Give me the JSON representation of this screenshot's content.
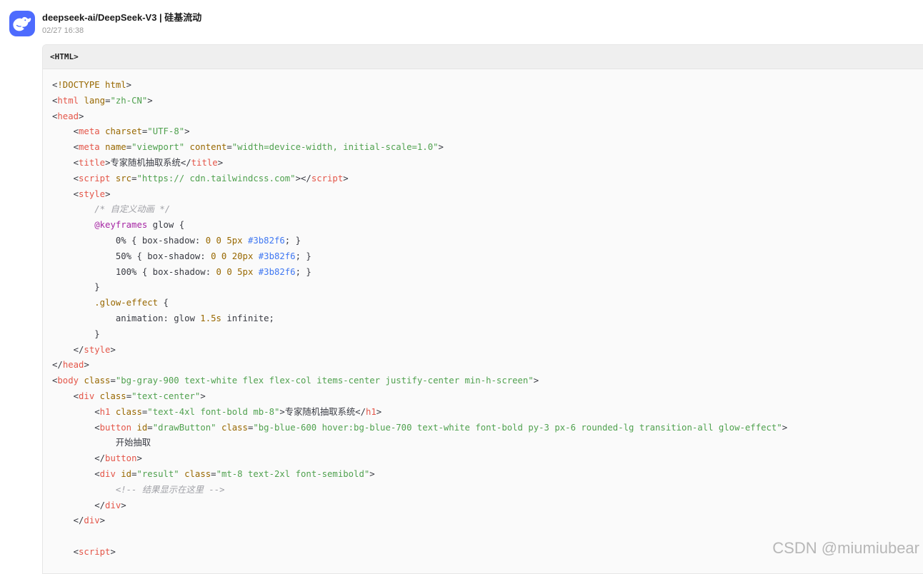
{
  "message": {
    "title": "deepseek-ai/DeepSeek-V3 | 硅基流动",
    "timestamp": "02/27 16:38",
    "avatar_icon": "deepseek-whale-icon",
    "avatar_color": "#4d6bfe"
  },
  "code_block": {
    "language_label": "<HTML>",
    "lines": [
      [
        [
          "p",
          "<"
        ],
        [
          "a",
          "!DOCTYPE"
        ],
        [
          "p",
          " "
        ],
        [
          "a",
          "html"
        ],
        [
          "p",
          ">"
        ]
      ],
      [
        [
          "p",
          "<"
        ],
        [
          "t",
          "html"
        ],
        [
          "p",
          " "
        ],
        [
          "a",
          "lang"
        ],
        [
          "p",
          "="
        ],
        [
          "s",
          "\"zh-CN\""
        ],
        [
          "p",
          ">"
        ]
      ],
      [
        [
          "p",
          "<"
        ],
        [
          "t",
          "head"
        ],
        [
          "p",
          ">"
        ]
      ],
      [
        [
          "p",
          "    <"
        ],
        [
          "t",
          "meta"
        ],
        [
          "p",
          " "
        ],
        [
          "a",
          "charset"
        ],
        [
          "p",
          "="
        ],
        [
          "s",
          "\"UTF-8\""
        ],
        [
          "p",
          ">"
        ]
      ],
      [
        [
          "p",
          "    <"
        ],
        [
          "t",
          "meta"
        ],
        [
          "p",
          " "
        ],
        [
          "a",
          "name"
        ],
        [
          "p",
          "="
        ],
        [
          "s",
          "\"viewport\""
        ],
        [
          "p",
          " "
        ],
        [
          "a",
          "content"
        ],
        [
          "p",
          "="
        ],
        [
          "s",
          "\"width=device-width, initial-scale=1.0\""
        ],
        [
          "p",
          ">"
        ]
      ],
      [
        [
          "p",
          "    <"
        ],
        [
          "t",
          "title"
        ],
        [
          "p",
          ">专家随机抽取系统</"
        ],
        [
          "t",
          "title"
        ],
        [
          "p",
          ">"
        ]
      ],
      [
        [
          "p",
          "    <"
        ],
        [
          "t",
          "script"
        ],
        [
          "p",
          " "
        ],
        [
          "a",
          "src"
        ],
        [
          "p",
          "="
        ],
        [
          "s",
          "\"https:// cdn.tailwindcss.com\""
        ],
        [
          "p",
          "></"
        ],
        [
          "t",
          "script"
        ],
        [
          "p",
          ">"
        ]
      ],
      [
        [
          "p",
          "    <"
        ],
        [
          "t",
          "style"
        ],
        [
          "p",
          ">"
        ]
      ],
      [
        [
          "p",
          "        "
        ],
        [
          "c",
          "/* 自定义动画 */"
        ]
      ],
      [
        [
          "p",
          "        "
        ],
        [
          "k",
          "@keyframes"
        ],
        [
          "p",
          " glow {"
        ]
      ],
      [
        [
          "p",
          "            0% { box-shadow: "
        ],
        [
          "n",
          "0"
        ],
        [
          "p",
          " "
        ],
        [
          "n",
          "0"
        ],
        [
          "p",
          " "
        ],
        [
          "n",
          "5px"
        ],
        [
          "p",
          " "
        ],
        [
          "h",
          "#3b82f6"
        ],
        [
          "p",
          "; }"
        ]
      ],
      [
        [
          "p",
          "            50% { box-shadow: "
        ],
        [
          "n",
          "0"
        ],
        [
          "p",
          " "
        ],
        [
          "n",
          "0"
        ],
        [
          "p",
          " "
        ],
        [
          "n",
          "20px"
        ],
        [
          "p",
          " "
        ],
        [
          "h",
          "#3b82f6"
        ],
        [
          "p",
          "; }"
        ]
      ],
      [
        [
          "p",
          "            100% { box-shadow: "
        ],
        [
          "n",
          "0"
        ],
        [
          "p",
          " "
        ],
        [
          "n",
          "0"
        ],
        [
          "p",
          " "
        ],
        [
          "n",
          "5px"
        ],
        [
          "p",
          " "
        ],
        [
          "h",
          "#3b82f6"
        ],
        [
          "p",
          "; }"
        ]
      ],
      [
        [
          "p",
          "        }"
        ]
      ],
      [
        [
          "p",
          "        "
        ],
        [
          "sel",
          ".glow-effect"
        ],
        [
          "p",
          " {"
        ]
      ],
      [
        [
          "p",
          "            animation: glow "
        ],
        [
          "n",
          "1.5s"
        ],
        [
          "p",
          " infinite;"
        ]
      ],
      [
        [
          "p",
          "        }"
        ]
      ],
      [
        [
          "p",
          "    </"
        ],
        [
          "t",
          "style"
        ],
        [
          "p",
          ">"
        ]
      ],
      [
        [
          "p",
          "</"
        ],
        [
          "t",
          "head"
        ],
        [
          "p",
          ">"
        ]
      ],
      [
        [
          "p",
          "<"
        ],
        [
          "t",
          "body"
        ],
        [
          "p",
          " "
        ],
        [
          "a",
          "class"
        ],
        [
          "p",
          "="
        ],
        [
          "s",
          "\"bg-gray-900 text-white flex flex-col items-center justify-center min-h-screen\""
        ],
        [
          "p",
          ">"
        ]
      ],
      [
        [
          "p",
          "    <"
        ],
        [
          "t",
          "div"
        ],
        [
          "p",
          " "
        ],
        [
          "a",
          "class"
        ],
        [
          "p",
          "="
        ],
        [
          "s",
          "\"text-center\""
        ],
        [
          "p",
          ">"
        ]
      ],
      [
        [
          "p",
          "        <"
        ],
        [
          "t",
          "h1"
        ],
        [
          "p",
          " "
        ],
        [
          "a",
          "class"
        ],
        [
          "p",
          "="
        ],
        [
          "s",
          "\"text-4xl font-bold mb-8\""
        ],
        [
          "p",
          ">专家随机抽取系统</"
        ],
        [
          "t",
          "h1"
        ],
        [
          "p",
          ">"
        ]
      ],
      [
        [
          "p",
          "        <"
        ],
        [
          "t",
          "button"
        ],
        [
          "p",
          " "
        ],
        [
          "a",
          "id"
        ],
        [
          "p",
          "="
        ],
        [
          "s",
          "\"drawButton\""
        ],
        [
          "p",
          " "
        ],
        [
          "a",
          "class"
        ],
        [
          "p",
          "="
        ],
        [
          "s",
          "\"bg-blue-600 hover:bg-blue-700 text-white font-bold py-3 px-6 rounded-lg transition-all glow-effect\""
        ],
        [
          "p",
          ">"
        ]
      ],
      [
        [
          "p",
          "            开始抽取"
        ]
      ],
      [
        [
          "p",
          "        </"
        ],
        [
          "t",
          "button"
        ],
        [
          "p",
          ">"
        ]
      ],
      [
        [
          "p",
          "        <"
        ],
        [
          "t",
          "div"
        ],
        [
          "p",
          " "
        ],
        [
          "a",
          "id"
        ],
        [
          "p",
          "="
        ],
        [
          "s",
          "\"result\""
        ],
        [
          "p",
          " "
        ],
        [
          "a",
          "class"
        ],
        [
          "p",
          "="
        ],
        [
          "s",
          "\"mt-8 text-2xl font-semibold\""
        ],
        [
          "p",
          ">"
        ]
      ],
      [
        [
          "p",
          "            "
        ],
        [
          "c",
          "<!-- 结果显示在这里 -->"
        ]
      ],
      [
        [
          "p",
          "        </"
        ],
        [
          "t",
          "div"
        ],
        [
          "p",
          ">"
        ]
      ],
      [
        [
          "p",
          "    </"
        ],
        [
          "t",
          "div"
        ],
        [
          "p",
          ">"
        ]
      ],
      [
        [
          "p",
          ""
        ]
      ],
      [
        [
          "p",
          "    <"
        ],
        [
          "t",
          "script"
        ],
        [
          "p",
          ">"
        ]
      ]
    ]
  },
  "watermark": "CSDN @miumiubear",
  "syntax_colors": {
    "tag": "#e45649",
    "attribute": "#986801",
    "string": "#50a14f",
    "comment": "#a0a1a7",
    "keyword": "#a626a4",
    "number": "#986801",
    "hex": "#4078f2"
  }
}
